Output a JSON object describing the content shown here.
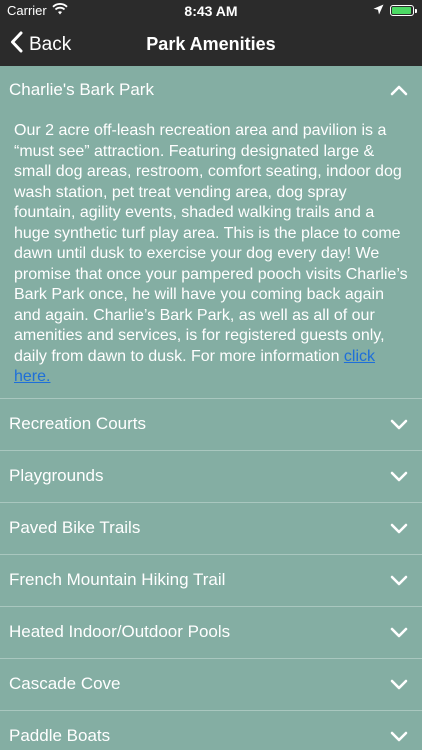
{
  "status": {
    "carrier": "Carrier",
    "time": "8:43 AM"
  },
  "nav": {
    "back_label": "Back",
    "title": "Park Amenities"
  },
  "expanded": {
    "title": "Charlie's Bark Park",
    "description": "Our 2 acre off-leash recreation area and pavilion is a “must see” attraction. Featuring designated large & small dog areas, restroom, comfort seating, indoor dog wash station, pet treat vending area, dog spray fountain, agility events, shaded walking trails and a huge synthetic turf play area. This is the place to come dawn until dusk to exercise your dog every day! We promise that once your pampered pooch visits Charlie’s Bark Park once, he will have you coming back again and again. Charlie’s Bark Park, as well as all of our amenities and services, is for registered guests only, daily from dawn to dusk. For more information ",
    "link_text": "click here."
  },
  "sections": [
    {
      "title": "Recreation Courts"
    },
    {
      "title": "Playgrounds"
    },
    {
      "title": "Paved Bike Trails"
    },
    {
      "title": "French Mountain Hiking Trail"
    },
    {
      "title": "Heated Indoor/Outdoor Pools"
    },
    {
      "title": "Cascade Cove"
    },
    {
      "title": "Paddle Boats"
    }
  ],
  "colors": {
    "bar": "#2b2b2b",
    "background": "#84aea3",
    "link": "#1e6fd9",
    "battery": "#4cd964"
  },
  "icons": {
    "collapse": "chevron-up-icon",
    "expand": "chevron-down-icon",
    "back": "chevron-left-icon"
  }
}
